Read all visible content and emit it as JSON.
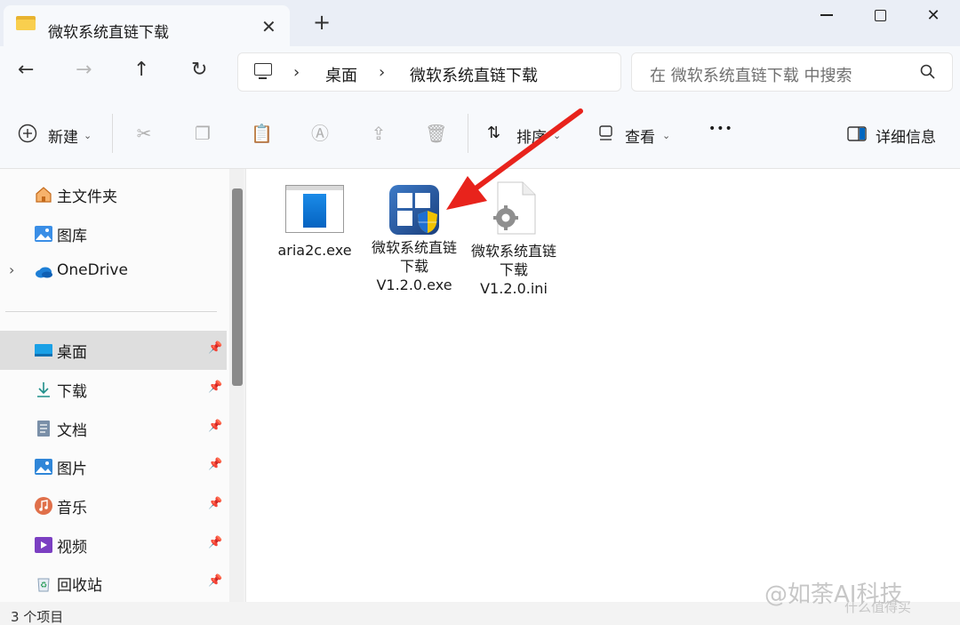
{
  "tab": {
    "title": "微软系统直链下载",
    "close": "✕",
    "new": "+"
  },
  "window": {
    "close": "✕"
  },
  "nav": {
    "back": "←",
    "forward": "→",
    "up": "↑",
    "refresh": "↻",
    "sep": "›",
    "crumbs": [
      "桌面",
      "微软系统直链下载"
    ]
  },
  "search": {
    "placeholder": "在 微软系统直链下载 中搜索"
  },
  "commands": {
    "new": "新建",
    "sort": "排序",
    "view": "查看",
    "more": "•••",
    "details": "详细信息"
  },
  "sidebar": {
    "top": [
      {
        "label": "主文件夹",
        "icon": "home-icon"
      },
      {
        "label": "图库",
        "icon": "gallery-icon"
      },
      {
        "label": "OneDrive",
        "icon": "cloud-icon"
      }
    ],
    "pinned": [
      {
        "label": "桌面",
        "icon": "desktop-icon",
        "active": true
      },
      {
        "label": "下载",
        "icon": "download-icon"
      },
      {
        "label": "文档",
        "icon": "document-icon"
      },
      {
        "label": "图片",
        "icon": "pictures-icon"
      },
      {
        "label": "音乐",
        "icon": "music-icon"
      },
      {
        "label": "视频",
        "icon": "video-icon"
      },
      {
        "label": "回收站",
        "icon": "recycle-bin-icon"
      }
    ]
  },
  "files": [
    {
      "name": "aria2c.exe",
      "icon": "exe-icon"
    },
    {
      "name": "微软系统直链下载V1.2.0.exe",
      "icon": "app-shield-icon"
    },
    {
      "name": "微软系统直链下载V1.2.0.ini",
      "icon": "ini-settings-icon"
    }
  ],
  "status": {
    "count": "3 个项目"
  },
  "watermark": {
    "text": "@如荼AI科技",
    "sub": "什么值得买"
  },
  "colors": {
    "accent": "#0067c0",
    "arrow": "#e8231c",
    "folder": "#f9cf4e"
  }
}
